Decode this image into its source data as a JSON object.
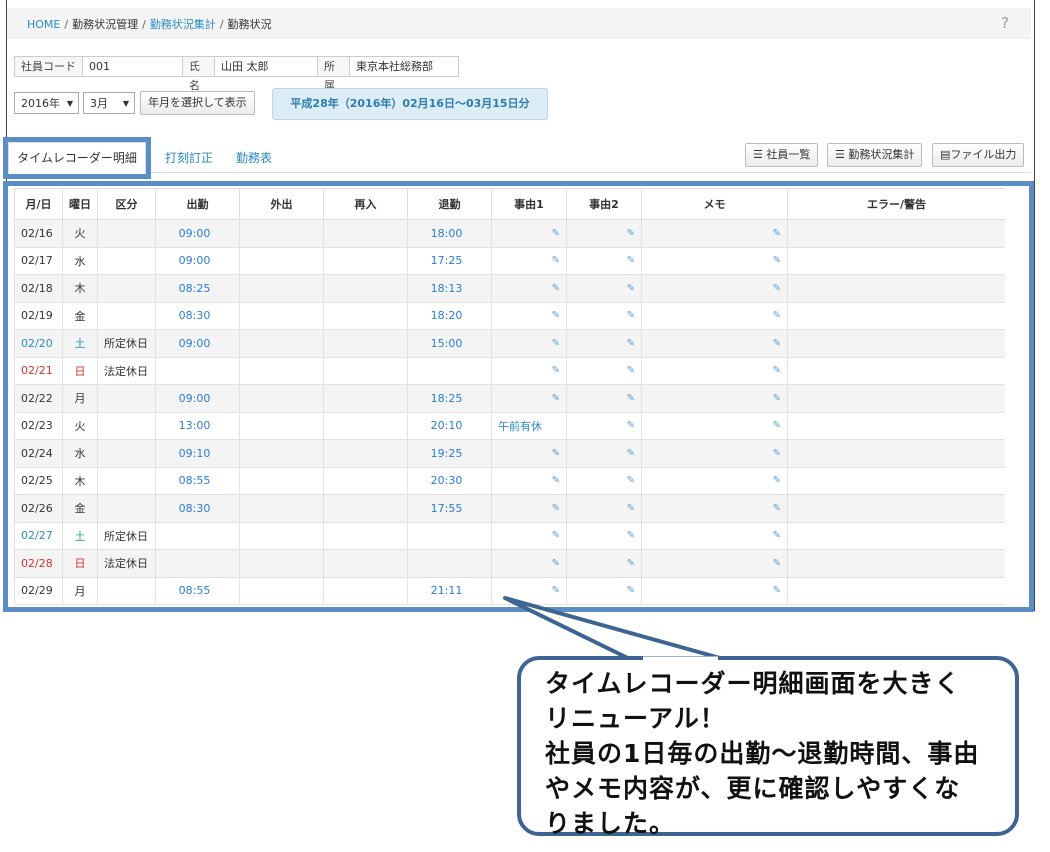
{
  "breadcrumb": {
    "home": "HOME",
    "item1": "勤務状況管理",
    "item2": "勤務状況集計",
    "current": "勤務状況",
    "sep": "/"
  },
  "help_label": "?",
  "employee": {
    "code_label": "社員コード",
    "code": "001",
    "name_label": "氏名",
    "name": "山田 太郎",
    "dept_label": "所属",
    "dept": "東京本社総務部"
  },
  "controls": {
    "year": "2016年",
    "month": "3月",
    "show_button": "年月を選択して表示",
    "period": "平成28年（2016年）02月16日〜03月15日分"
  },
  "tabs": {
    "active": "タイムレコーダー明細",
    "tab2": "打刻訂正",
    "tab3": "勤務表"
  },
  "right_buttons": {
    "employee_list": "社員一覧",
    "summary": "勤務状況集計",
    "export": "ファイル出力"
  },
  "table": {
    "headers": [
      "月/日",
      "曜日",
      "区分",
      "出勤",
      "外出",
      "再入",
      "退勤",
      "事由1",
      "事由2",
      "メモ",
      "エラー/警告"
    ],
    "rows": [
      {
        "date": "02/16",
        "day": "火",
        "kubun": "",
        "in": "09:00",
        "out": "18:00",
        "reason1": "",
        "type": "normal"
      },
      {
        "date": "02/17",
        "day": "水",
        "kubun": "",
        "in": "09:00",
        "out": "17:25",
        "reason1": "",
        "type": "normal"
      },
      {
        "date": "02/18",
        "day": "木",
        "kubun": "",
        "in": "08:25",
        "out": "18:13",
        "reason1": "",
        "type": "normal"
      },
      {
        "date": "02/19",
        "day": "金",
        "kubun": "",
        "in": "08:30",
        "out": "18:20",
        "reason1": "",
        "type": "normal"
      },
      {
        "date": "02/20",
        "day": "土",
        "kubun": "所定休日",
        "in": "09:00",
        "out": "15:00",
        "reason1": "",
        "type": "sat"
      },
      {
        "date": "02/21",
        "day": "日",
        "kubun": "法定休日",
        "in": "",
        "out": "",
        "reason1": "",
        "type": "sun"
      },
      {
        "date": "02/22",
        "day": "月",
        "kubun": "",
        "in": "09:00",
        "out": "18:25",
        "reason1": "",
        "type": "normal"
      },
      {
        "date": "02/23",
        "day": "火",
        "kubun": "",
        "in": "13:00",
        "out": "20:10",
        "reason1": "午前有休",
        "type": "normal"
      },
      {
        "date": "02/24",
        "day": "水",
        "kubun": "",
        "in": "09:10",
        "out": "19:25",
        "reason1": "",
        "type": "normal"
      },
      {
        "date": "02/25",
        "day": "木",
        "kubun": "",
        "in": "08:55",
        "out": "20:30",
        "reason1": "",
        "type": "normal"
      },
      {
        "date": "02/26",
        "day": "金",
        "kubun": "",
        "in": "08:30",
        "out": "17:55",
        "reason1": "",
        "type": "normal"
      },
      {
        "date": "02/27",
        "day": "土",
        "kubun": "所定休日",
        "in": "",
        "out": "",
        "reason1": "",
        "type": "sat"
      },
      {
        "date": "02/28",
        "day": "日",
        "kubun": "法定休日",
        "in": "",
        "out": "",
        "reason1": "",
        "type": "sun"
      },
      {
        "date": "02/29",
        "day": "月",
        "kubun": "",
        "in": "08:55",
        "out": "21:11",
        "reason1": "",
        "type": "normal"
      }
    ]
  },
  "callout": {
    "line1": "タイムレコーダー明細画面を大きく",
    "line2": "リニューアル！",
    "line3": "社員の1日毎の出勤〜退勤時間、事由",
    "line4": "やメモ内容が、更に確認しやすくな",
    "line5": "りました。"
  },
  "colors": {
    "accent": "#2a8cc4",
    "highlight_border": "#5b8ec4",
    "sunday": "#d0342c",
    "callout_border": "#3e6592"
  }
}
